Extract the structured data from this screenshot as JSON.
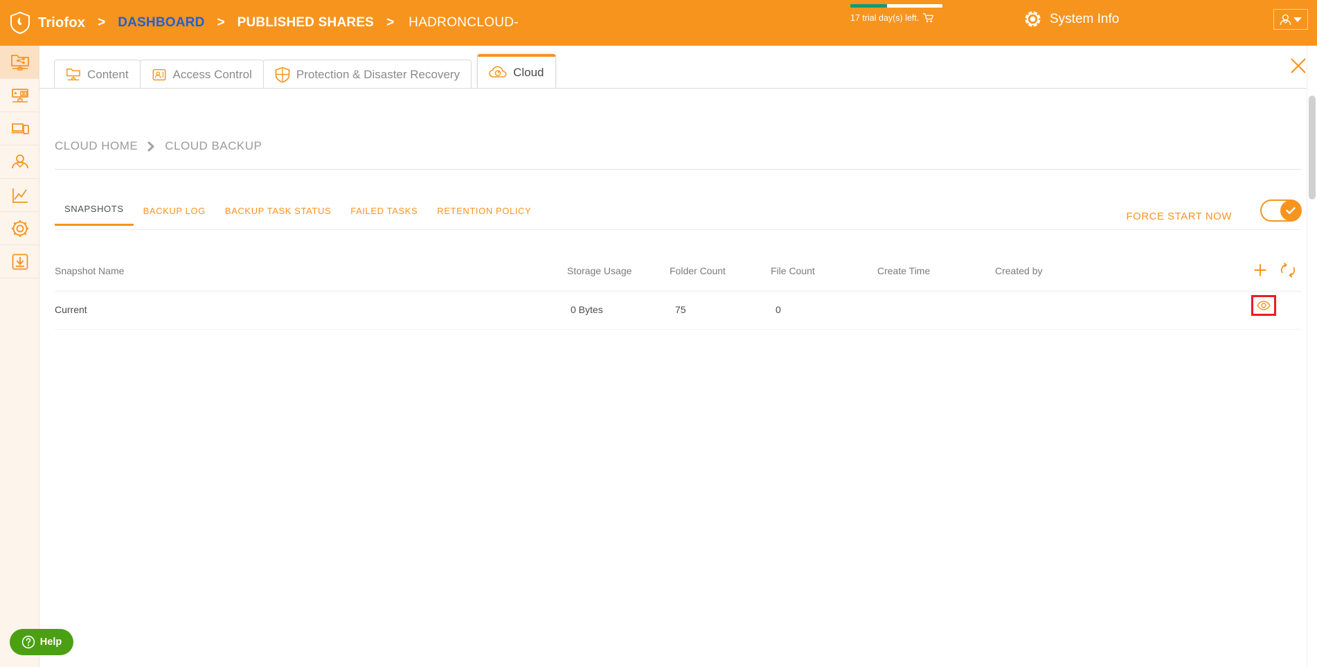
{
  "header": {
    "brand": "Triofox",
    "logo_icon": "shield-icon",
    "breadcrumb": [
      {
        "label": "DASHBOARD",
        "style": "link"
      },
      {
        "label": "PUBLISHED SHARES",
        "style": "plain"
      },
      {
        "label": "HADRONCLOUD-",
        "style": "last"
      }
    ],
    "separator": ">",
    "trial": {
      "text": "17 trial day(s) left.",
      "cart_icon": "shopping-cart-icon",
      "progress_percent": 40,
      "bar_fill_color": "#0f9b77",
      "bar_track_color": "#ffffff"
    },
    "system_info": {
      "label": "System Info",
      "icon": "gear-icon"
    },
    "user_menu": {
      "icon": "user-icon",
      "caret": "chevron-down-icon"
    },
    "background_color": "#F7941E"
  },
  "sidebar": {
    "items": [
      {
        "name": "shared-folder",
        "icon": "shared-folder-icon",
        "active": true
      },
      {
        "name": "server",
        "icon": "server-monitor-icon",
        "active": false
      },
      {
        "name": "devices",
        "icon": "devices-icon",
        "active": false
      },
      {
        "name": "users",
        "icon": "user-icon",
        "active": false
      },
      {
        "name": "reports",
        "icon": "chart-line-icon",
        "active": false
      },
      {
        "name": "settings",
        "icon": "gear-icon",
        "active": false
      },
      {
        "name": "downloads",
        "icon": "download-icon",
        "active": false
      }
    ],
    "background_color": "#FDF4EC",
    "active_color": "#FBE0C4"
  },
  "tabs": [
    {
      "label": "Content",
      "icon": "folder-network-icon",
      "active": false
    },
    {
      "label": "Access Control",
      "icon": "access-control-icon",
      "active": false
    },
    {
      "label": "Protection & Disaster Recovery",
      "icon": "shield-protection-icon",
      "active": false
    },
    {
      "label": "Cloud",
      "icon": "cloud-sync-icon",
      "active": true
    }
  ],
  "close_button": {
    "icon": "close-icon"
  },
  "breadcrumb_page": {
    "items": [
      "CLOUD HOME",
      "CLOUD BACKUP"
    ],
    "separator_icon": "chevron-right-icon"
  },
  "subtabs": [
    {
      "label": "SNAPSHOTS",
      "active": true
    },
    {
      "label": "BACKUP LOG",
      "active": false
    },
    {
      "label": "BACKUP TASK STATUS",
      "active": false
    },
    {
      "label": "FAILED TASKS",
      "active": false
    },
    {
      "label": "RETENTION POLICY",
      "active": false
    }
  ],
  "actions": {
    "force_start_label": "FORCE START NOW",
    "toggle": {
      "state": "on",
      "icon": "check-icon"
    }
  },
  "table": {
    "columns": [
      {
        "key": "name",
        "label": "Snapshot Name"
      },
      {
        "key": "storage",
        "label": "Storage Usage"
      },
      {
        "key": "folders",
        "label": "Folder Count"
      },
      {
        "key": "files",
        "label": "File Count"
      },
      {
        "key": "created",
        "label": "Create Time"
      },
      {
        "key": "by",
        "label": "Created by"
      }
    ],
    "header_actions": [
      {
        "name": "add-snapshot",
        "icon": "plus-icon"
      },
      {
        "name": "refresh",
        "icon": "refresh-icon"
      }
    ],
    "rows": [
      {
        "name": "Current",
        "storage": "0 Bytes",
        "folders": "75",
        "files": "0",
        "created": "",
        "by": "",
        "row_action": {
          "name": "view-snapshot",
          "icon": "eye-icon",
          "highlighted": true,
          "highlight_color": "#ec1c24"
        }
      }
    ]
  },
  "help": {
    "label": "Help",
    "icon": "question-circle-icon",
    "color": "#4aa011"
  },
  "colors": {
    "accent": "#F7941E",
    "link": "#1f5fd6",
    "text_muted": "#7b7b7b",
    "text_dark": "#4a4a4a"
  }
}
